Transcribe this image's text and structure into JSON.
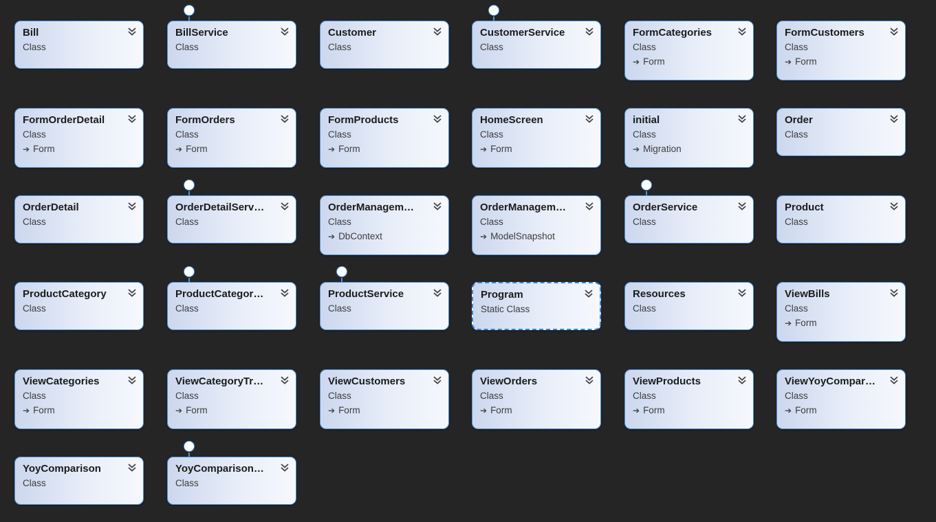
{
  "diagram": {
    "types": [
      {
        "name": "Bill",
        "kind": "Class",
        "base": "",
        "interface": false
      },
      {
        "name": "BillService",
        "kind": "Class",
        "base": "",
        "interface": true
      },
      {
        "name": "Customer",
        "kind": "Class",
        "base": "",
        "interface": false
      },
      {
        "name": "CustomerService",
        "kind": "Class",
        "base": "",
        "interface": true
      },
      {
        "name": "FormCategories",
        "kind": "Class",
        "base": "Form",
        "interface": false
      },
      {
        "name": "FormCustomers",
        "kind": "Class",
        "base": "Form",
        "interface": false
      },
      {
        "name": "FormOrderDetail",
        "kind": "Class",
        "base": "Form",
        "interface": false
      },
      {
        "name": "FormOrders",
        "kind": "Class",
        "base": "Form",
        "interface": false
      },
      {
        "name": "FormProducts",
        "kind": "Class",
        "base": "Form",
        "interface": false
      },
      {
        "name": "HomeScreen",
        "kind": "Class",
        "base": "Form",
        "interface": false
      },
      {
        "name": "initial",
        "kind": "Class",
        "base": "Migration",
        "interface": false
      },
      {
        "name": "Order",
        "kind": "Class",
        "base": "",
        "interface": false
      },
      {
        "name": "OrderDetail",
        "kind": "Class",
        "base": "",
        "interface": false
      },
      {
        "name": "OrderDetailServ…",
        "kind": "Class",
        "base": "",
        "interface": true
      },
      {
        "name": "OrderManagem…",
        "kind": "Class",
        "base": "DbContext",
        "interface": false
      },
      {
        "name": "OrderManagem…",
        "kind": "Class",
        "base": "ModelSnapshot",
        "interface": false
      },
      {
        "name": "OrderService",
        "kind": "Class",
        "base": "",
        "interface": true
      },
      {
        "name": "Product",
        "kind": "Class",
        "base": "",
        "interface": false
      },
      {
        "name": "ProductCategory",
        "kind": "Class",
        "base": "",
        "interface": false
      },
      {
        "name": "ProductCategor…",
        "kind": "Class",
        "base": "",
        "interface": true
      },
      {
        "name": "ProductService",
        "kind": "Class",
        "base": "",
        "interface": true
      },
      {
        "name": "Program",
        "kind": "Static Class",
        "base": "",
        "interface": false,
        "selected": true
      },
      {
        "name": "Resources",
        "kind": "Class",
        "base": "",
        "interface": false
      },
      {
        "name": "ViewBills",
        "kind": "Class",
        "base": "Form",
        "interface": false
      },
      {
        "name": "ViewCategories",
        "kind": "Class",
        "base": "Form",
        "interface": false
      },
      {
        "name": "ViewCategoryTr…",
        "kind": "Class",
        "base": "Form",
        "interface": false
      },
      {
        "name": "ViewCustomers",
        "kind": "Class",
        "base": "Form",
        "interface": false
      },
      {
        "name": "ViewOrders",
        "kind": "Class",
        "base": "Form",
        "interface": false
      },
      {
        "name": "ViewProducts",
        "kind": "Class",
        "base": "Form",
        "interface": false
      },
      {
        "name": "ViewYoyCompar…",
        "kind": "Class",
        "base": "Form",
        "interface": false
      },
      {
        "name": "YoyComparison",
        "kind": "Class",
        "base": "",
        "interface": false
      },
      {
        "name": "YoyComparison…",
        "kind": "Class",
        "base": "",
        "interface": true
      }
    ]
  },
  "icons": {
    "expand": "chevron-double-down-icon",
    "inherit": "inheritance-arrow-icon",
    "interface": "interface-lollipop-icon"
  },
  "colors": {
    "background": "#252526",
    "border": "#4f93d6",
    "selected_border": "#2f86e4"
  }
}
